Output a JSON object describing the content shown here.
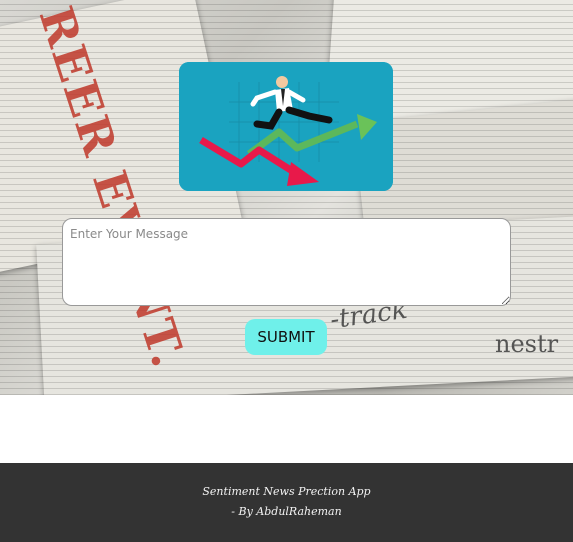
{
  "form": {
    "message_placeholder": "Enter Your Message",
    "message_value": "",
    "submit_label": "SUBMIT"
  },
  "footer": {
    "line1": "Sentiment News Prection App",
    "line2": "- By AbdulRaheman"
  },
  "background": {
    "headline_fragment": "REER EVENT.",
    "track_fragment": "-track",
    "nestr_fragment": "nestr"
  },
  "colors": {
    "logo_bg": "#1aa3c0",
    "submit_bg": "#6ff0ea",
    "footer_bg": "#333333"
  },
  "icons": [
    "businessman-jumping-icon",
    "green-up-arrow-icon",
    "red-down-arrow-icon"
  ]
}
